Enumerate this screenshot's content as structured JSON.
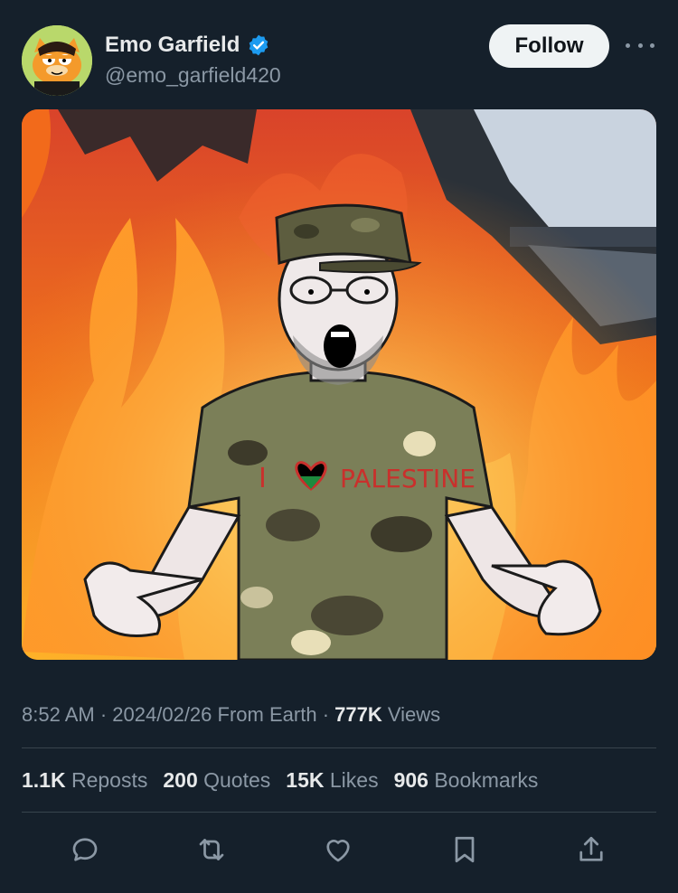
{
  "user": {
    "display_name": "Emo Garfield",
    "handle": "@emo_garfield420",
    "verified": true,
    "follow_label": "Follow"
  },
  "media": {
    "shirt_text_i": "I",
    "shirt_text_palestine": "PALESTINE"
  },
  "meta": {
    "time": "8:52 AM",
    "date": "2024/02/26",
    "location": "From Earth",
    "views_count": "777K",
    "views_label": "Views",
    "sep": "·"
  },
  "stats": {
    "reposts_count": "1.1K",
    "reposts_label": "Reposts",
    "quotes_count": "200",
    "quotes_label": "Quotes",
    "likes_count": "15K",
    "likes_label": "Likes",
    "bookmarks_count": "906",
    "bookmarks_label": "Bookmarks"
  },
  "actions": {
    "icons": [
      "reply-icon",
      "repost-icon",
      "like-icon",
      "bookmark-icon",
      "share-icon"
    ]
  },
  "colors": {
    "background": "#15202b",
    "secondary_text": "#8b98a5",
    "verified_blue": "#1d9bf0",
    "icon": "#8b98a5"
  }
}
